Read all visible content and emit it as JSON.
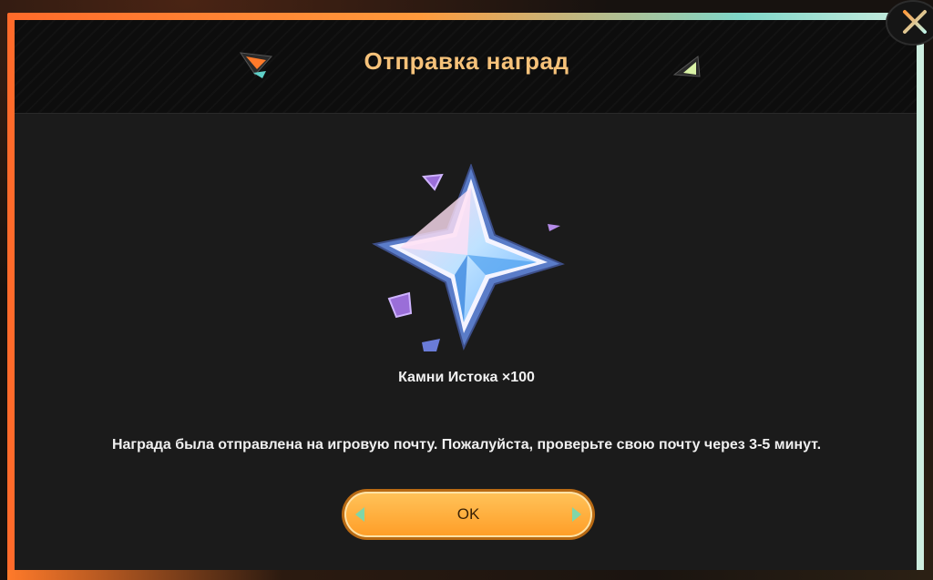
{
  "dialog": {
    "title": "Отправка наград",
    "close_icon": "close-icon",
    "reward": {
      "icon": "primogem-star-icon",
      "label": "Камни Истока ×100"
    },
    "message": "Награда была отправлена на игровую почту. Пожалуйста, проверьте свою почту через 3-5 минут.",
    "ok_label": "OK"
  },
  "colors": {
    "title": "#f6c27a",
    "button": "#ffa834",
    "frame_left": "#ff6a2a",
    "frame_right": "#cfeee0",
    "panel": "#1b1b1b"
  }
}
